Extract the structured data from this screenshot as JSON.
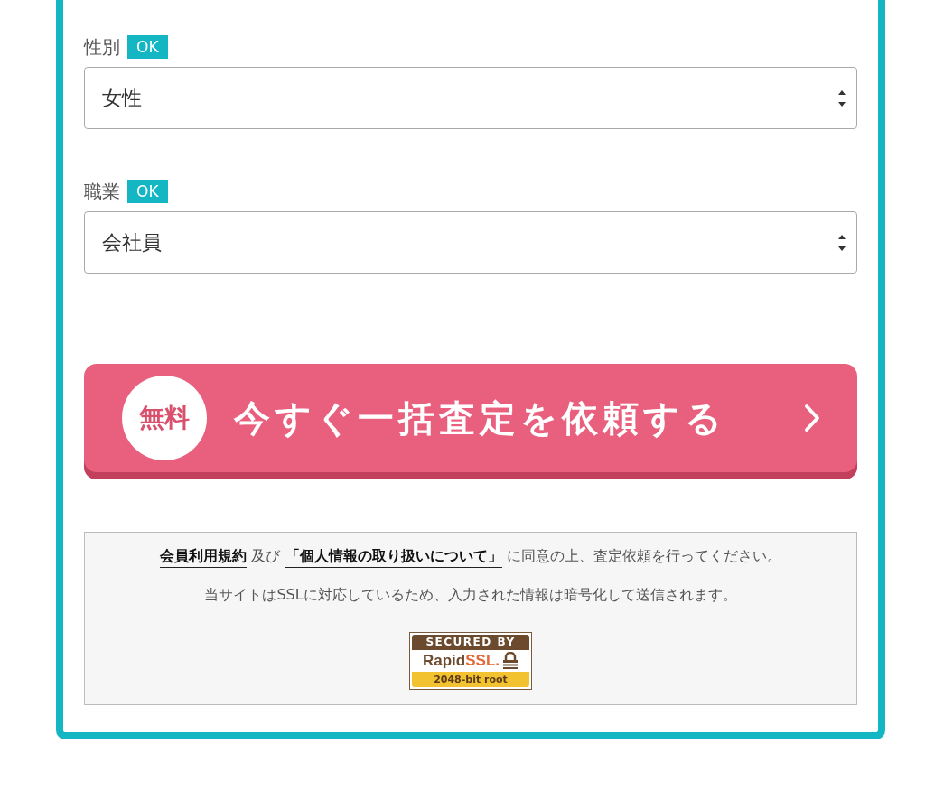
{
  "fields": [
    {
      "label": "性別",
      "status": "OK",
      "value": "女性"
    },
    {
      "label": "職業",
      "status": "OK",
      "value": "会社員"
    }
  ],
  "submit": {
    "badge": "無料",
    "label": "今すぐ一括査定を依頼する"
  },
  "notice": {
    "agreement": [
      {
        "kind": "link",
        "text": "会員利用規約"
      },
      {
        "kind": "text",
        "text": " 及び "
      },
      {
        "kind": "link",
        "text": "「個人情報の取り扱いについて」"
      },
      {
        "kind": "text",
        "text": " に同意の上、査定依頼を行ってください。"
      }
    ],
    "ssl_note": "当サイトはSSLに対応しているため、入力された情報は暗号化して送信されます。",
    "seal": {
      "top": "SECURED BY",
      "brand": "Rapid",
      "brand_accent": "SSL.",
      "bottom": "2048-bit root"
    }
  }
}
